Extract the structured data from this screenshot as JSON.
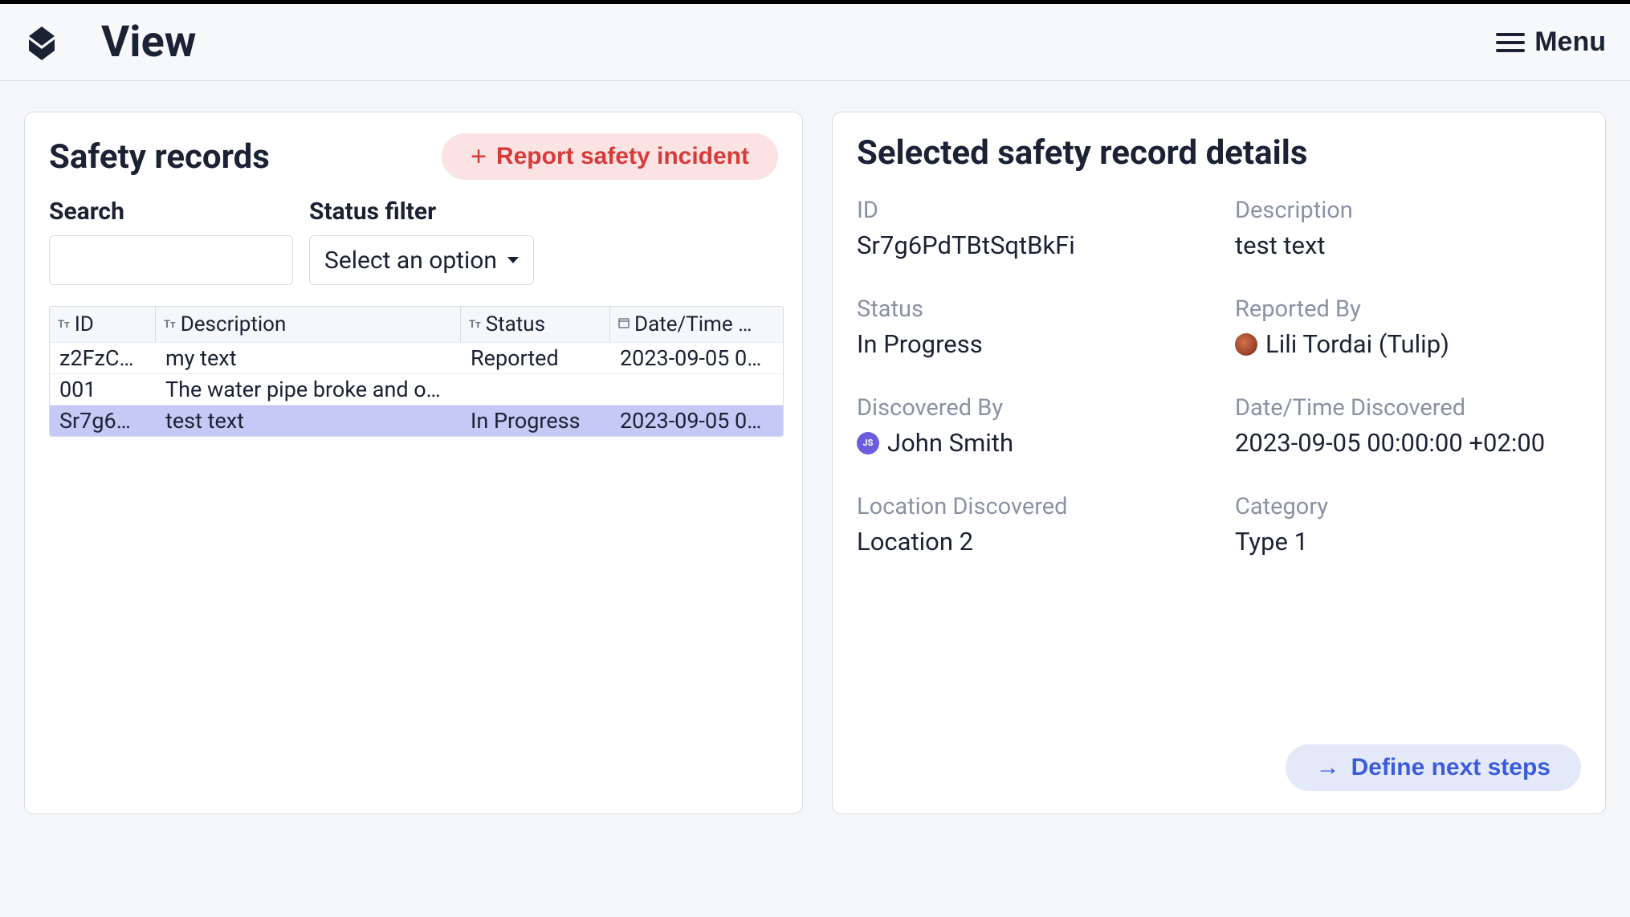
{
  "header": {
    "title": "View",
    "menu_label": "Menu"
  },
  "left_panel": {
    "title": "Safety records",
    "report_button": "Report safety incident",
    "search_label": "Search",
    "search_value": "",
    "status_filter_label": "Status filter",
    "status_filter_placeholder": "Select an option",
    "table": {
      "columns": [
        "ID",
        "Description",
        "Status",
        "Date/Time …"
      ],
      "rows": [
        {
          "id": "z2FzC…",
          "description": "my text",
          "status": "Reported",
          "date": "2023-09-05 0…",
          "selected": false
        },
        {
          "id": "001",
          "description": "The water pipe broke and o…",
          "status": "",
          "date": "",
          "selected": false
        },
        {
          "id": "Sr7g6…",
          "description": "test text",
          "status": "In Progress",
          "date": "2023-09-05 0…",
          "selected": true
        }
      ]
    }
  },
  "right_panel": {
    "title": "Selected safety record details",
    "fields": {
      "id_label": "ID",
      "id_value": "Sr7g6PdTBtSqtBkFi",
      "description_label": "Description",
      "description_value": "test text",
      "status_label": "Status",
      "status_value": "In Progress",
      "reported_by_label": "Reported By",
      "reported_by_value": "Lili Tordai (Tulip)",
      "discovered_by_label": "Discovered By",
      "discovered_by_value": "John Smith",
      "discovered_by_initials": "JS",
      "date_discovered_label": "Date/Time Discovered",
      "date_discovered_value": "2023-09-05 00:00:00 +02:00",
      "location_label": "Location Discovered",
      "location_value": "Location 2",
      "category_label": "Category",
      "category_value": "Type 1"
    },
    "define_button": "Define next steps"
  }
}
